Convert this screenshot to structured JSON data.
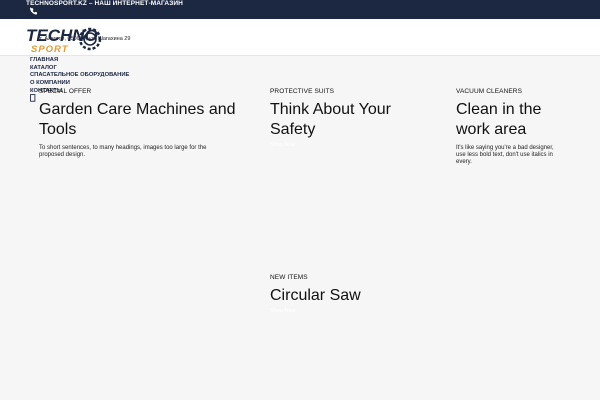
{
  "topbar": {
    "text": "TECHNOSPORT.KZ – НАШ ИНТЕРНЕТ-МАГАЗИН"
  },
  "header": {
    "address": "г. Алматы, 050000, ул. Шагахина 29",
    "logo_line1": "TECHNO",
    "logo_line2": "SPORT"
  },
  "nav": {
    "items": [
      {
        "label": "Главная"
      },
      {
        "label": "Каталог"
      },
      {
        "label": "Спасательное оборудование"
      },
      {
        "label": "О компании"
      },
      {
        "label": "Контакты"
      }
    ]
  },
  "cards": [
    {
      "eyebrow": "SPECIAL OFFER",
      "title": "Garden Care Machines and Tools",
      "desc": "To short sentences, to many headings, images too large for the proposed design."
    },
    {
      "eyebrow": "PROTECTIVE SUITS",
      "title": "Think About Your Safety",
      "more": "Shop Now"
    },
    {
      "eyebrow": "VACUUM CLEANERS",
      "title": "Clean in the work area",
      "desc": "It's like saying you're a bad designer, use less bold text, don't use italics in every."
    },
    {
      "eyebrow": "NEW ITEMS",
      "title": "Circular Saw",
      "more": "Shop Now"
    }
  ],
  "colors": {
    "topbar_bg": "#1c2742",
    "nav_text": "#1c2742",
    "logo_accent": "#e0993a",
    "page_bg": "#f6f6f6"
  },
  "icons": [
    "phone-icon",
    "search-icon",
    "gear-logo-icon"
  ]
}
